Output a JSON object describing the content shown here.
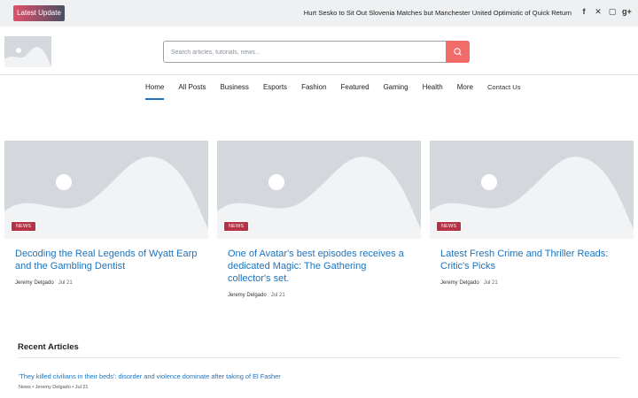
{
  "topbar": {
    "badge": "Latest Update",
    "ticker": "Hurt Sesko to Sit Out Slovenia Matches but Manchester United Optimistic of Quick Return",
    "social": [
      "facebook-icon",
      "twitter-icon",
      "instagram-icon",
      "google-plus-icon"
    ],
    "social_glyphs": [
      "f",
      "✕",
      "▢",
      "g+"
    ]
  },
  "search": {
    "placeholder": "Search articles, tutorials, news...",
    "button_icon": "search-icon",
    "button_color": "#f26b6b"
  },
  "nav": {
    "items": [
      "Home",
      "All Posts",
      "Business",
      "Esports",
      "Fashion",
      "Featured",
      "Gaming",
      "Health",
      "More",
      "Contact Us"
    ],
    "active": "Home"
  },
  "cards": [
    {
      "tag": "NEWS",
      "title": "Decoding the Real Legends of Wyatt Earp and the Gambling Dentist",
      "author": "Jeremy Delgado",
      "date": "Jul 21"
    },
    {
      "tag": "NEWS",
      "title": "One of Avatar's best episodes receives a dedicated Magic: The Gathering collector's set.",
      "author": "Jeremy Delgado",
      "date": "Jul 21"
    },
    {
      "tag": "NEWS",
      "title": "Latest Fresh Crime and Thriller Reads: Critic's Picks",
      "author": "Jeremy Delgado",
      "date": "Jul 21"
    }
  ],
  "recent": {
    "heading": "Recent Articles",
    "items": [
      {
        "title": "'They killed civilians in their beds': disorder and violence dominate after taking of El Fasher",
        "meta": "News • Jeremy Delgado • Jul 21"
      }
    ]
  },
  "colors": {
    "accent": "#1e73be",
    "tag": "#b83247",
    "placeholder": "#d4d8dd"
  }
}
